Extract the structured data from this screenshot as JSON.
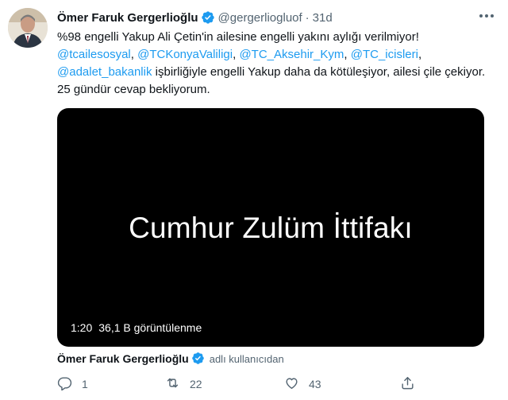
{
  "tweet": {
    "author_name": "Ömer Faruk Gergerlioğlu",
    "handle": "@gergerliogluof",
    "separator": "·",
    "time": "31d",
    "text_line1": "%98 engelli Yakup Ali Çetin'in ailesine engelli yakını aylığı verilmiyor!",
    "mentions": [
      "@tcailesosyal",
      "@TCKonyaValiligi",
      "@TC_Aksehir_Kym",
      "@TC_icisleri",
      "@adalet_bakanlik"
    ],
    "mention_sep": ", ",
    "text_tail": "işbirliğiyle engelli Yakup daha da kötüleşiyor, ailesi çile çekiyor. 25 gündür cevap bekliyorum.",
    "video": {
      "title": "Cumhur Zulüm İttifakı",
      "duration": "1:20",
      "views": "36,1 B görüntülenme"
    },
    "attribution": {
      "name": "Ömer Faruk Gergerlioğlu",
      "suffix": "adlı kullanıcıdan"
    },
    "actions": {
      "reply_count": "1",
      "retweet_count": "22",
      "like_count": "43"
    },
    "colors": {
      "link": "#1d9bf0",
      "verified": "#1d9bf0",
      "muted": "#536471",
      "video_bg": "#000000"
    },
    "icons": [
      "verified-badge-icon",
      "more-icon",
      "reply-icon",
      "retweet-icon",
      "like-icon",
      "share-icon"
    ]
  }
}
